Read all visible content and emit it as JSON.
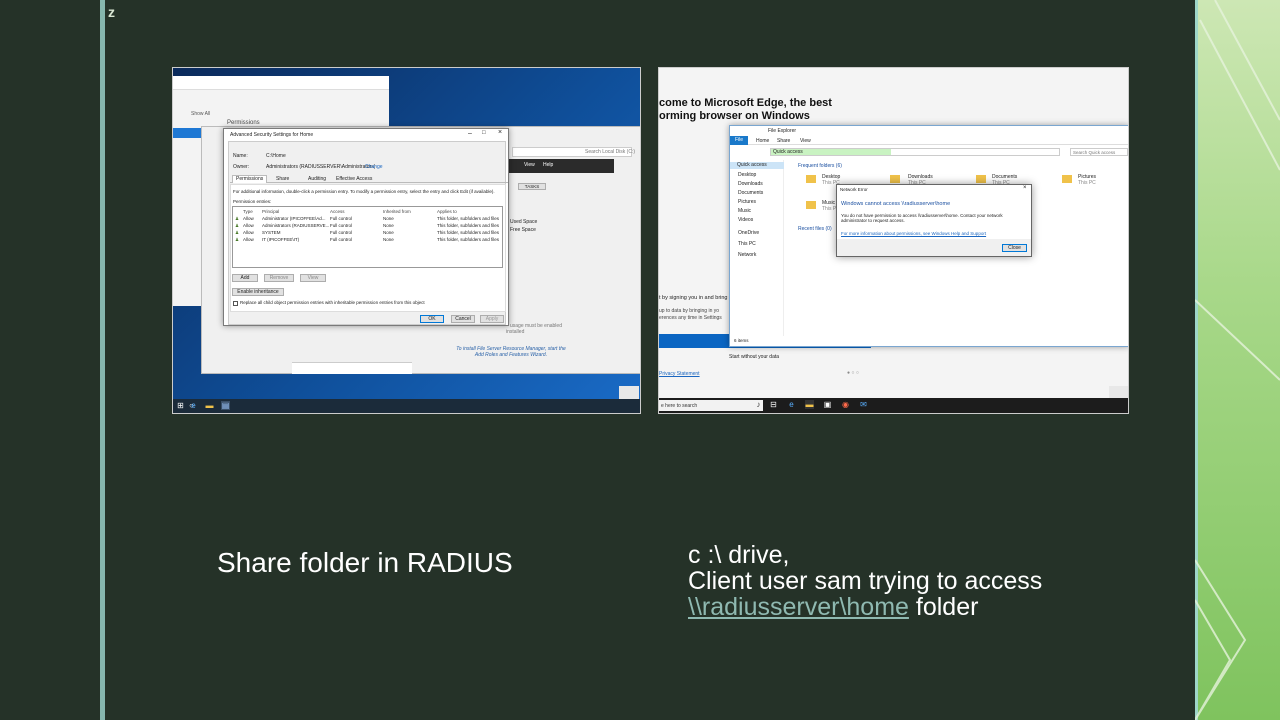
{
  "captions": {
    "left": "Share folder in RADIUS",
    "right_line1": "c :\\ drive,",
    "right_line2": "Client user sam trying to access",
    "right_link": "\\\\radiusserver\\home",
    "right_suffix": " folder"
  },
  "shot1": {
    "bg_window": {
      "show_all": "Show All",
      "permissions": "Permissions",
      "search": "Search Local Disk (C:)",
      "tasks": "TASKS",
      "menu": [
        "View",
        "Help"
      ],
      "side_text": [
        "Used Space",
        "Free Space"
      ],
      "bottom_note": "To install File Server Resource Manager, start the Add Roles and Features Wizard.",
      "quota_note": "usage must be enabled",
      "installed": "installed"
    },
    "dialog": {
      "title": "Advanced Security Settings for Home",
      "name_label": "Name:",
      "name_value": "C:\\Home",
      "owner_label": "Owner:",
      "owner_value": "Administrators (RADIUSSERVER\\Administrators)",
      "owner_link": "Change",
      "tabs": [
        "Permissions",
        "Share",
        "Auditing",
        "Effective Access"
      ],
      "info": "For additional information, double-click a permission entry. To modify a permission entry, select the entry and click Edit (if available).",
      "entries_label": "Permission entries:",
      "columns": [
        "Type",
        "Principal",
        "Access",
        "Inherited from",
        "Applies to"
      ],
      "rows": [
        [
          "Allow",
          "Administrator (IPICOFFEE\\Ad...",
          "Full control",
          "None",
          "This folder, subfolders and files"
        ],
        [
          "Allow",
          "Administrators (RADIUSSERVE...",
          "Full control",
          "None",
          "This folder, subfolders and files"
        ],
        [
          "Allow",
          "SYSTEM",
          "Full control",
          "None",
          "This folder, subfolders and files"
        ],
        [
          "Allow",
          "IT (IPICOFFEE\\IT)",
          "Full control",
          "None",
          "This folder, subfolders and files"
        ]
      ],
      "add": "Add",
      "remove": "Remove",
      "view": "View",
      "enable_inheritance": "Enable inheritance",
      "replace_text": "Replace all child object permission entries with inheritable permission entries from this object",
      "ok": "OK",
      "cancel": "Cancel",
      "apply": "Apply"
    }
  },
  "shot2": {
    "edge_title_line1": "come to Microsoft Edge, the best",
    "edge_title_line2": "orming browser on Windows",
    "edge_sign": "t by signing you in and bring",
    "edge_sync1": "up to data by bringing in yo",
    "edge_sync2": "erences any time in Settings",
    "edge_start": "Start without your data",
    "edge_privacy": "Privacy Statement",
    "explorer": {
      "title": "File Explorer",
      "ribbon": [
        "File",
        "Home",
        "Share",
        "View"
      ],
      "address": "Quick access",
      "search": "Search Quick access",
      "nav": [
        "Quick access",
        "Desktop",
        "Downloads",
        "Documents",
        "Pictures",
        "Music",
        "Videos",
        "OneDrive",
        "This PC",
        "Network"
      ],
      "frequent": "Frequent folders (6)",
      "recent": "Recent files (0)",
      "folders": [
        {
          "name": "Desktop",
          "sub": "This PC"
        },
        {
          "name": "Downloads",
          "sub": "This PC"
        },
        {
          "name": "Documents",
          "sub": "This PC"
        },
        {
          "name": "Pictures",
          "sub": "This PC"
        },
        {
          "name": "Music",
          "sub": "This PC"
        }
      ],
      "status": "6 items"
    },
    "error": {
      "title": "Network Error",
      "heading": "Windows cannot access \\\\radiusserver\\home",
      "body": "You do not have permission to access \\\\radiusserver\\home. Contact your network administrator to request access.",
      "link": "For more information about permissions, see Windows Help and Support",
      "close": "Close"
    },
    "taskbar_search": "e here to search"
  }
}
